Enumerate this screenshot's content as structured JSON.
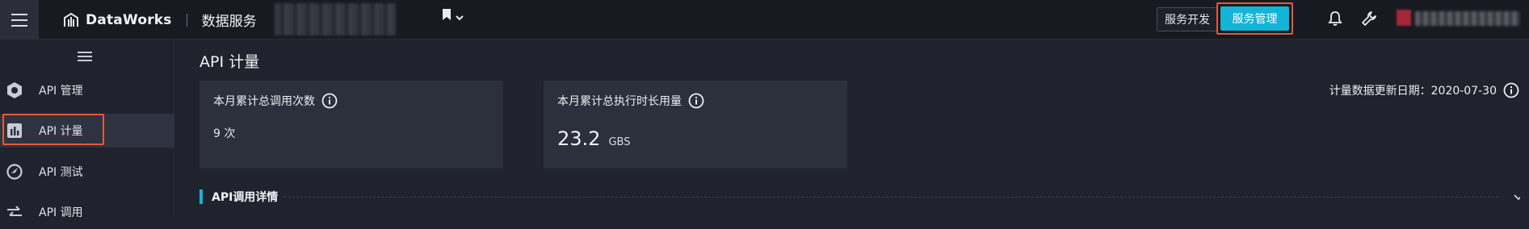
{
  "topbar": {
    "brand_name": "DataWorks",
    "brand_sub": "数据服务",
    "service_dev_label": "服务开发",
    "service_manage_label": "服务管理"
  },
  "sidebar": {
    "items": [
      {
        "label": "API 管理",
        "icon": "hexagon-gear-icon"
      },
      {
        "label": "API 计量",
        "icon": "bar-chart-icon"
      },
      {
        "label": "API 测试",
        "icon": "gauge-check-icon"
      },
      {
        "label": "API 调用",
        "icon": "swap-arrows-icon"
      }
    ]
  },
  "main": {
    "page_title": "API 计量",
    "cards": [
      {
        "title": "本月累计总调用次数",
        "value": "9 次"
      },
      {
        "title": "本月累计总执行时长用量",
        "value": "23.2",
        "unit": "GBS"
      }
    ],
    "update_date": "计量数据更新日期：2020-07-30",
    "section_title": "API调用详情"
  },
  "colors": {
    "accent": "#12b5d6",
    "highlight": "#e45a3a",
    "background": "#20232e",
    "card": "#2c2f3c",
    "topbar": "#181a22"
  }
}
